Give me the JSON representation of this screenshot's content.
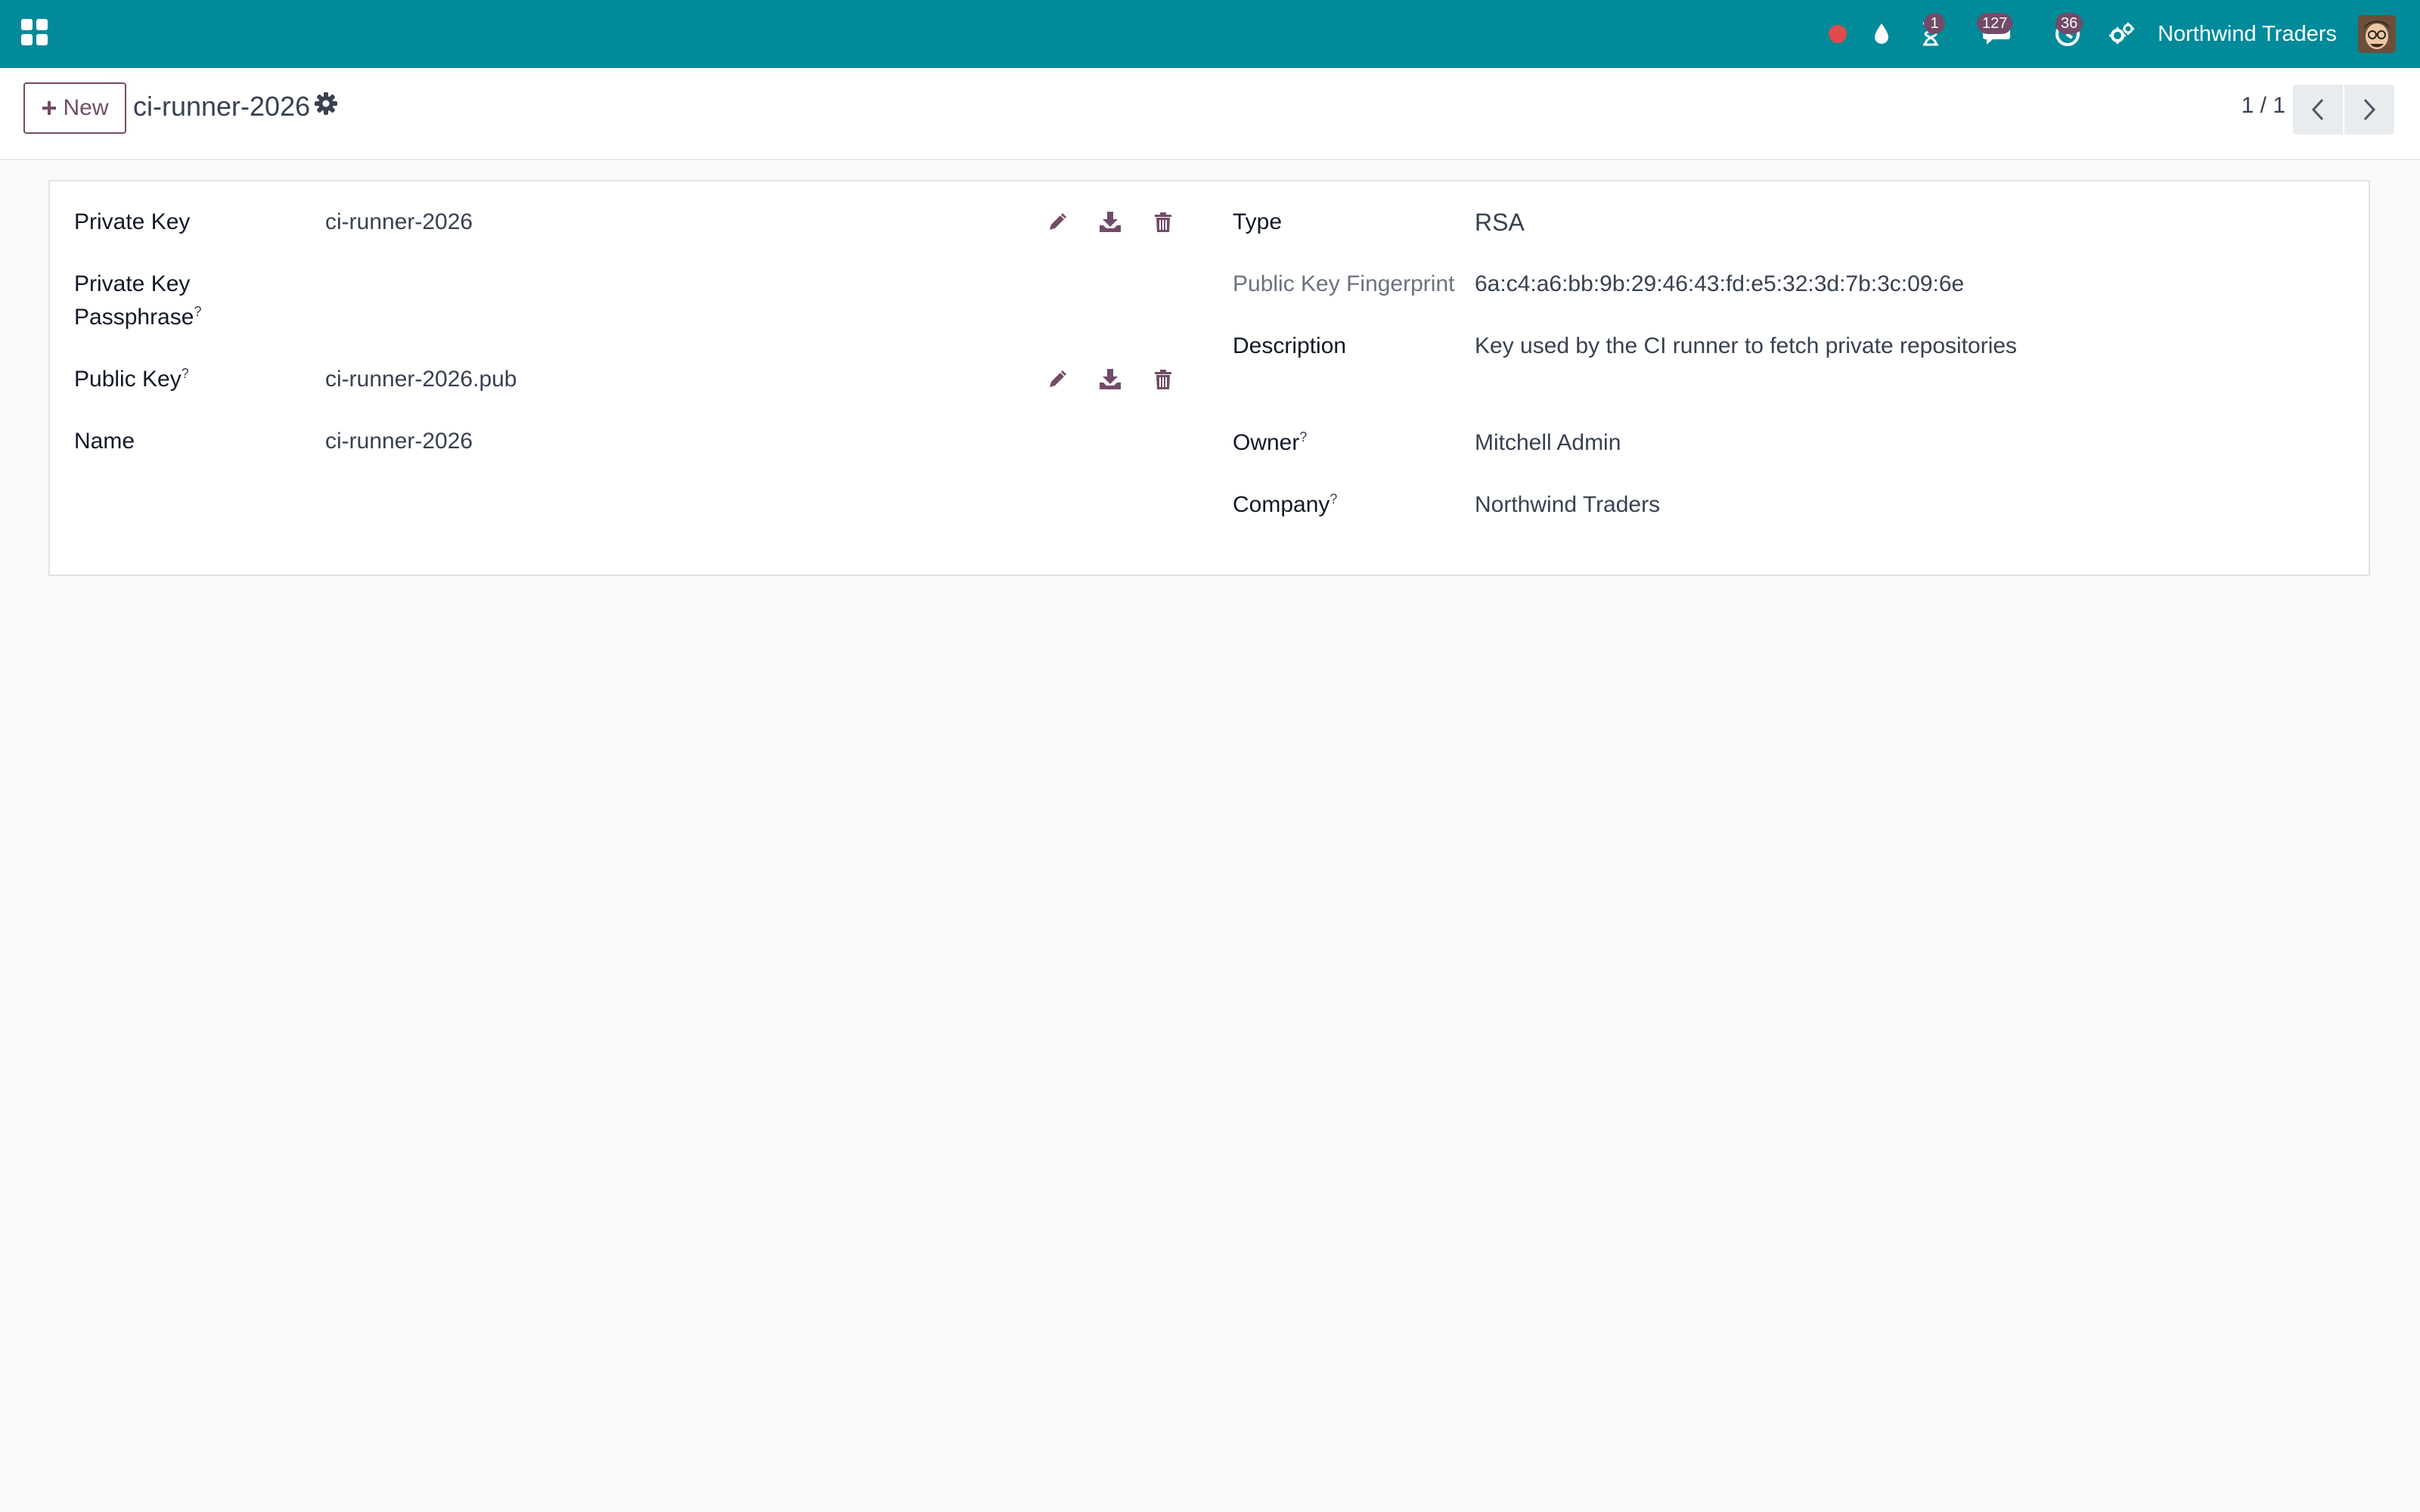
{
  "navbar": {
    "company": "Northwind Traders",
    "badges": {
      "activities": "1",
      "messages": "127",
      "timers": "36"
    },
    "icons": [
      "apps-icon",
      "record-dot-icon",
      "water-drop-icon",
      "hourglass-icon",
      "chat-icon",
      "clock-icon",
      "settings-icon"
    ]
  },
  "control_panel": {
    "new_label": "New",
    "record_title": "ci-runner-2026",
    "pager": "1 / 1"
  },
  "form": {
    "left": {
      "private_key": {
        "label": "Private Key",
        "value": "ci-runner-2026"
      },
      "passphrase": {
        "label_line1": "Private Key",
        "label_line2": "Passphrase",
        "help": "?"
      },
      "public_key": {
        "label": "Public Key",
        "help": "?",
        "value": "ci-runner-2026.pub"
      },
      "name": {
        "label": "Name",
        "value": "ci-runner-2026"
      }
    },
    "right": {
      "type": {
        "label": "Type",
        "value": "RSA"
      },
      "fingerprint": {
        "label": "Public Key Fingerprint",
        "value": "6a:c4:a6:bb:9b:29:46:43:fd:e5:32:3d:7b:3c:09:6e"
      },
      "description": {
        "label": "Description",
        "value": "Key used by the CI runner to fetch private repositories"
      },
      "owner": {
        "label": "Owner",
        "help": "?",
        "value": "Mitchell Admin"
      },
      "company": {
        "label": "Company",
        "help": "?",
        "value": "Northwind Traders"
      }
    }
  },
  "colors": {
    "navbar": "#008a9a",
    "accent": "#714b67",
    "record_dot": "#e04b4b"
  }
}
